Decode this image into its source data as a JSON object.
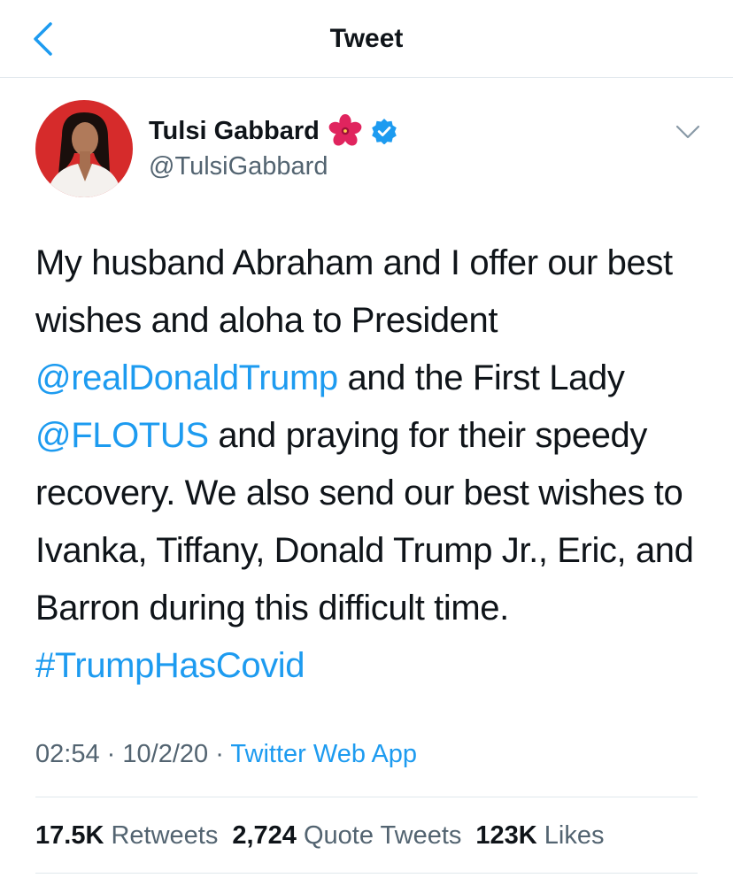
{
  "header": {
    "title": "Tweet",
    "back_icon": "chevron-left-icon"
  },
  "tweet": {
    "author": {
      "name": "Tulsi Gabbard",
      "handle": "@TulsiGabbard",
      "name_emoji_icon": "hibiscus-icon",
      "verified_icon": "verified-badge-icon"
    },
    "more_icon": "chevron-down-icon",
    "text_parts": [
      {
        "text": "My husband Abraham and I offer our best wishes and aloha to President ",
        "link": false
      },
      {
        "text": "@realDonaldTrump",
        "link": true
      },
      {
        "text": " and the First Lady ",
        "link": false
      },
      {
        "text": "@FLOTUS",
        "link": true
      },
      {
        "text": " and praying for their speedy recovery. We also send our best wishes to Ivanka, Tiffany, Donald Trump Jr., Eric, and Barron during this difficult time. ",
        "link": false
      },
      {
        "text": "#TrumpHasCovid",
        "link": true
      }
    ],
    "time": "02:54",
    "separator": "·",
    "date": "10/2/20",
    "source": "Twitter Web App",
    "stats": {
      "retweets_count": "17.5K",
      "retweets_label": "Retweets",
      "quotes_count": "2,724",
      "quotes_label": "Quote Tweets",
      "likes_count": "123K",
      "likes_label": "Likes"
    }
  },
  "colors": {
    "accent": "#1d9bf0",
    "text": "#0f1419",
    "secondary": "#536471",
    "avatar_bg": "#d62b2b",
    "divider": "#e1e8ed"
  }
}
